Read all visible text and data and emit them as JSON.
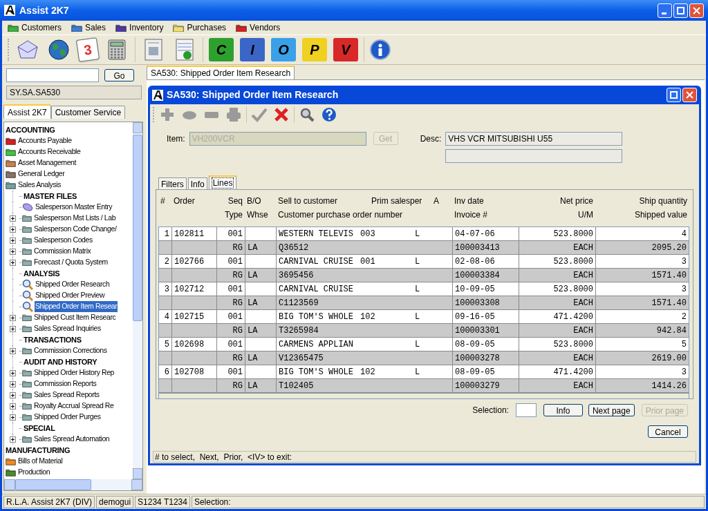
{
  "window": {
    "title": "Assist 2K7"
  },
  "menu": [
    {
      "label": "Customers",
      "color": "#3cb43c"
    },
    {
      "label": "Sales",
      "color": "#3a7fd8"
    },
    {
      "label": "Inventory",
      "color": "#4a3aa8"
    },
    {
      "label": "Purchases",
      "color": "#f0e070"
    },
    {
      "label": "Vendors",
      "color": "#d82020"
    }
  ],
  "toolbar": {
    "groups": [
      [
        {
          "kind": "mail"
        },
        {
          "kind": "globe"
        },
        {
          "kind": "calendar",
          "text": "3"
        },
        {
          "kind": "calculator"
        }
      ],
      [
        {
          "kind": "document"
        },
        {
          "kind": "report"
        }
      ],
      [
        {
          "kind": "folder",
          "text": "C",
          "color": "#2ea02e"
        },
        {
          "kind": "folder",
          "text": "I",
          "color": "#3a66c8"
        },
        {
          "kind": "folder",
          "text": "O",
          "color": "#3aa0e8"
        },
        {
          "kind": "folder",
          "text": "P",
          "color": "#f0d020"
        },
        {
          "kind": "folder",
          "text": "V",
          "color": "#d82828"
        }
      ],
      [
        {
          "kind": "info"
        }
      ]
    ]
  },
  "sidebar": {
    "search": {
      "button": "Go"
    },
    "path": "SY.SA.SA530",
    "tabs": [
      {
        "label": "Assist 2K7",
        "selected": true
      },
      {
        "label": "Customer Service",
        "selected": false
      }
    ],
    "tree": [
      {
        "kind": "section",
        "label": "ACCOUNTING"
      },
      {
        "kind": "module",
        "label": "Accounts Payable",
        "color": "#d81e1e",
        "selected": false
      },
      {
        "kind": "module",
        "label": "Accounts Receivable",
        "color": "#3cc83c",
        "selected": false
      },
      {
        "kind": "module",
        "label": "Asset Management",
        "color": "#c8824a",
        "selected": false
      },
      {
        "kind": "module",
        "label": "General Ledger",
        "color": "#8a7262",
        "selected": false
      },
      {
        "kind": "module",
        "label": "Sales Analysis",
        "color": "#7aa0a0",
        "selected": false,
        "children": [
          {
            "kind": "section",
            "label": "MASTER FILES"
          },
          {
            "kind": "entry",
            "label": "Salesperson Master Entry",
            "selected": false
          },
          {
            "kind": "folder",
            "label": "Salesperson Mst Lists / Lab",
            "expanded": false,
            "selected": false
          },
          {
            "kind": "folder",
            "label": "Salesperson Code Change/",
            "expanded": false,
            "selected": false
          },
          {
            "kind": "folder",
            "label": "Salesperson Codes",
            "expanded": false,
            "selected": false
          },
          {
            "kind": "folder",
            "label": "Commission Matrix",
            "expanded": false,
            "selected": false
          },
          {
            "kind": "folder",
            "label": "Forecast / Quota System",
            "expanded": false,
            "selected": false
          },
          {
            "kind": "section",
            "label": "ANALYSIS"
          },
          {
            "kind": "inquiry",
            "label": "Shipped Order Research",
            "selected": false
          },
          {
            "kind": "inquiry",
            "label": "Shipped Order Preview",
            "selected": false
          },
          {
            "kind": "inquiry",
            "label": "Shipped Order Item Resear",
            "selected": true
          },
          {
            "kind": "folder",
            "label": "Shipped Cust Item Researc",
            "expanded": false,
            "selected": false
          },
          {
            "kind": "folder",
            "label": "Sales Spread Inquiries",
            "expanded": false,
            "selected": false
          },
          {
            "kind": "section",
            "label": "TRANSACTIONS"
          },
          {
            "kind": "folder",
            "label": "Commission Corrections",
            "expanded": false,
            "selected": false
          },
          {
            "kind": "section",
            "label": "AUDIT AND HISTORY"
          },
          {
            "kind": "folder",
            "label": "Shipped Order History Rep",
            "expanded": false,
            "selected": false
          },
          {
            "kind": "folder",
            "label": "Commission Reports",
            "expanded": false,
            "selected": false
          },
          {
            "kind": "folder",
            "label": "Sales Spread Reports",
            "expanded": false,
            "selected": false
          },
          {
            "kind": "folder",
            "label": "Royalty Accrual Spread Re",
            "expanded": false,
            "selected": false
          },
          {
            "kind": "folder",
            "label": "Shipped Order Purges",
            "expanded": false,
            "selected": false
          },
          {
            "kind": "section",
            "label": "SPECIAL"
          },
          {
            "kind": "folder",
            "label": "Sales Spread Automation",
            "expanded": false,
            "selected": false
          }
        ]
      },
      {
        "kind": "section",
        "label": "MANUFACTURING"
      },
      {
        "kind": "module",
        "label": "Bills of Material",
        "color": "#f08a20",
        "selected": false
      },
      {
        "kind": "module",
        "label": "Production",
        "color": "#4a8a2a",
        "selected": false
      }
    ]
  },
  "document_tabs": [
    {
      "label": "SA530: Shipped Order Item Research",
      "selected": true
    }
  ],
  "dialog": {
    "title": "SA530: Shipped Order Item Research",
    "toolbar": {
      "groups": [
        [
          {
            "kind": "add",
            "disabled": true
          },
          {
            "kind": "pill",
            "disabled": true
          },
          {
            "kind": "remove",
            "disabled": true
          },
          {
            "kind": "print",
            "disabled": true
          }
        ],
        [
          {
            "kind": "check",
            "disabled": true
          },
          {
            "kind": "cancel",
            "disabled": false
          }
        ],
        [
          {
            "kind": "search",
            "disabled": false
          },
          {
            "kind": "help",
            "disabled": false
          }
        ]
      ]
    },
    "item": {
      "label": "Item:",
      "value": "VH200VCR",
      "disabled": true
    },
    "get_button": {
      "label": "Get",
      "disabled": true
    },
    "desc": {
      "label": "Desc:",
      "value": "VHS VCR MITSUBISHI U55"
    },
    "tabs": [
      {
        "label": "Filters",
        "selected": false
      },
      {
        "label": "Info",
        "selected": false
      },
      {
        "label": "Lines",
        "selected": true
      }
    ],
    "table": {
      "header_line_1": {
        "num": "#",
        "order": "Order",
        "seq": "Seq",
        "bo": "B/O",
        "customer": "Sell to customer",
        "salesper": "Prim salesper",
        "a": "A",
        "inv_date": "Inv date",
        "net_price": "Net price",
        "ship_qty": "Ship quantity"
      },
      "header_line_2": {
        "seq": "Type",
        "bo": "Whse",
        "customer": "Customer purchase order number",
        "inv_date": "Invoice #",
        "net_price": "U/M",
        "ship_qty": "Shipped value"
      },
      "rows": [
        {
          "num": "1",
          "order": "102811",
          "seq": "001",
          "customer": "WESTERN TELEVIS",
          "salesper": "003",
          "a": "L",
          "inv_date": "04-07-06",
          "net_price": "523.8000",
          "ship_qty": "4",
          "type": "RG",
          "whse": "LA",
          "po": "Q36512",
          "invoice": "100003413",
          "um": "EACH",
          "value": "2095.20"
        },
        {
          "num": "2",
          "order": "102766",
          "seq": "001",
          "customer": "CARNIVAL CRUISE",
          "salesper": "001",
          "a": "L",
          "inv_date": "02-08-06",
          "net_price": "523.8000",
          "ship_qty": "3",
          "type": "RG",
          "whse": "LA",
          "po": "3695456",
          "invoice": "100003384",
          "um": "EACH",
          "value": "1571.40"
        },
        {
          "num": "3",
          "order": "102712",
          "seq": "001",
          "customer": "CARNIVAL CRUISE",
          "a": "L",
          "inv_date": "10-09-05",
          "net_price": "523.8000",
          "ship_qty": "3",
          "type": "RG",
          "whse": "LA",
          "po": "C1123569",
          "invoice": "100003308",
          "um": "EACH",
          "value": "1571.40"
        },
        {
          "num": "4",
          "order": "102715",
          "seq": "001",
          "customer": "BIG TOM'S WHOLE",
          "salesper": "102",
          "a": "L",
          "inv_date": "09-16-05",
          "net_price": "471.4200",
          "ship_qty": "2",
          "type": "RG",
          "whse": "LA",
          "po": "T3265984",
          "invoice": "100003301",
          "um": "EACH",
          "value": "942.84"
        },
        {
          "num": "5",
          "order": "102698",
          "seq": "001",
          "customer": "CARMENS APPLIAN",
          "a": "L",
          "inv_date": "08-09-05",
          "net_price": "523.8000",
          "ship_qty": "5",
          "type": "RG",
          "whse": "LA",
          "po": "V12365475",
          "invoice": "100003278",
          "um": "EACH",
          "value": "2619.00"
        },
        {
          "num": "6",
          "order": "102708",
          "seq": "001",
          "customer": "BIG TOM'S WHOLE",
          "salesper": "102",
          "a": "L",
          "inv_date": "08-09-05",
          "net_price": "471.4200",
          "ship_qty": "3",
          "type": "RG",
          "whse": "LA",
          "po": "T102405",
          "invoice": "100003279",
          "um": "EACH",
          "value": "1414.26"
        }
      ]
    },
    "selection": {
      "label": "Selection:"
    },
    "buttons": [
      {
        "label": "Info",
        "disabled": false
      },
      {
        "label": "Next page",
        "disabled": false
      },
      {
        "label": "Prior page",
        "disabled": true
      }
    ],
    "cancel": "Cancel",
    "hint": "# to select,  Next,  Prior,  <IV> to exit:"
  },
  "status_bar": [
    "R.L.A. Assist 2K7 (DIV)",
    "demogui",
    "S1234 T1234",
    "Selection:"
  ]
}
